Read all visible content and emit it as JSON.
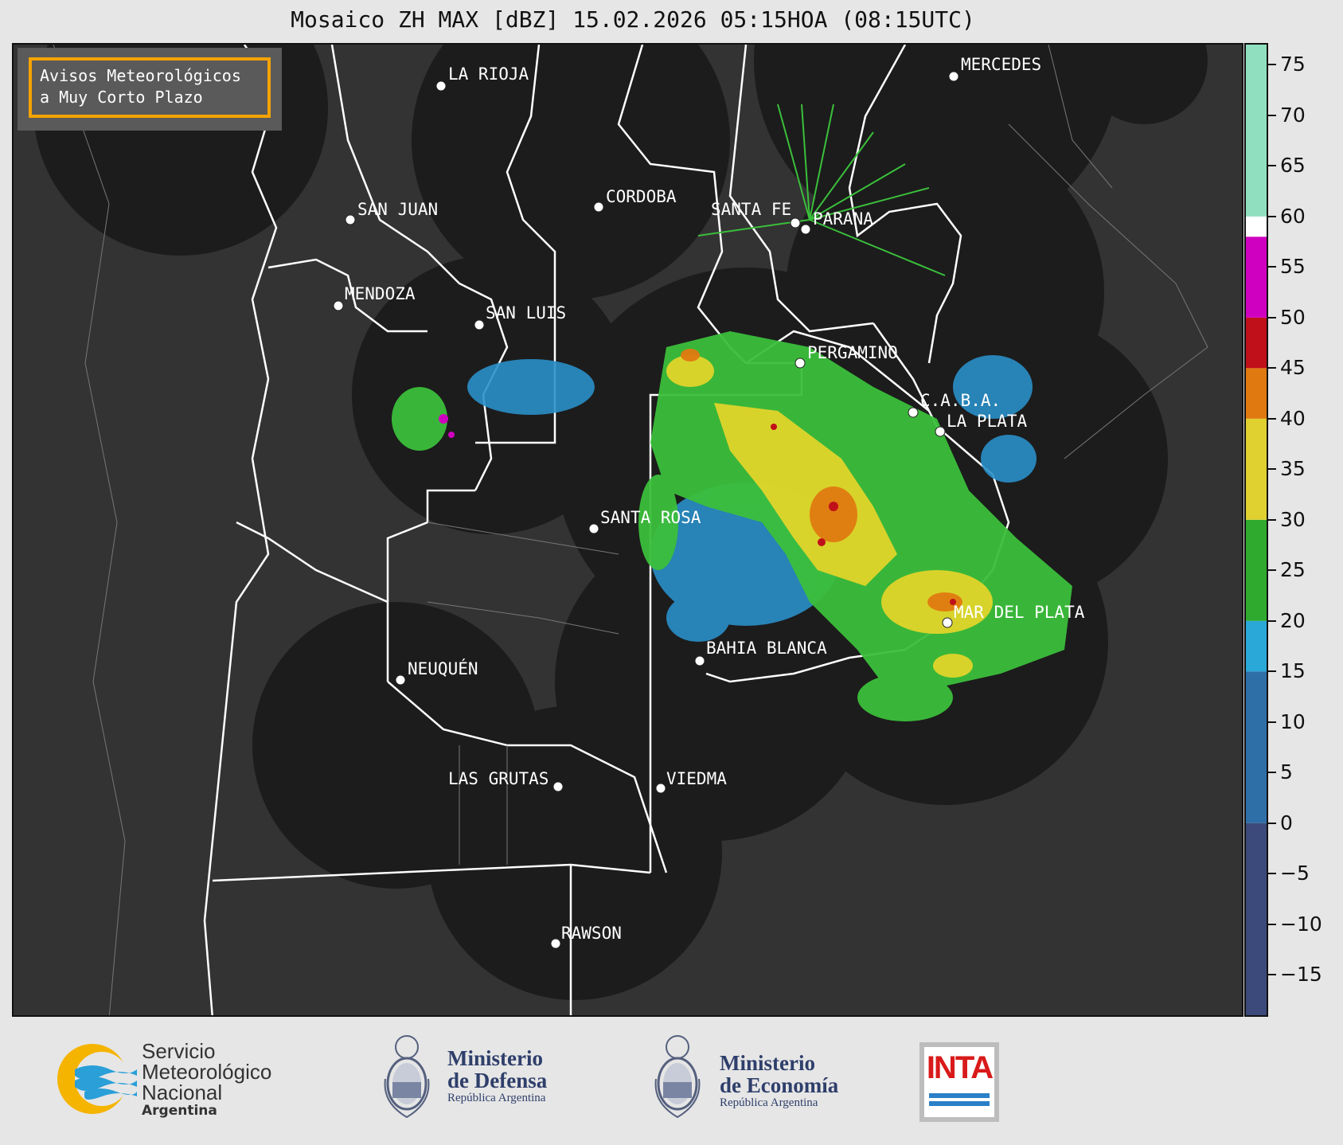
{
  "title": "Mosaico ZH MAX [dBZ] 15.02.2026 05:15HOA (08:15UTC)",
  "notice": {
    "line1": "Avisos Meteorológicos",
    "line2": "a Muy Corto Plazo"
  },
  "cities": [
    {
      "name": "LA RIOJA"
    },
    {
      "name": "MERCEDES"
    },
    {
      "name": "SAN JUAN"
    },
    {
      "name": "CORDOBA"
    },
    {
      "name": "SANTA FE"
    },
    {
      "name": "PARANA"
    },
    {
      "name": "MENDOZA"
    },
    {
      "name": "SAN LUIS"
    },
    {
      "name": "PERGAMINO"
    },
    {
      "name": "C.A.B.A."
    },
    {
      "name": "LA PLATA"
    },
    {
      "name": "SANTA ROSA"
    },
    {
      "name": "MAR DEL PLATA"
    },
    {
      "name": "BAHIA BLANCA"
    },
    {
      "name": "NEUQUÉN"
    },
    {
      "name": "LAS GRUTAS"
    },
    {
      "name": "VIEDMA"
    },
    {
      "name": "RAWSON"
    }
  ],
  "colorbar": {
    "unit": "dBZ",
    "min": -19,
    "max": 77,
    "ticks": [
      "75",
      "70",
      "65",
      "60",
      "55",
      "50",
      "45",
      "40",
      "35",
      "30",
      "25",
      "20",
      "15",
      "10",
      "5",
      "0",
      "−5",
      "−10",
      "−15"
    ],
    "tick_values": [
      75,
      70,
      65,
      60,
      55,
      50,
      45,
      40,
      35,
      30,
      25,
      20,
      15,
      10,
      5,
      0,
      -5,
      -10,
      -15
    ],
    "colors": {
      "below0": "#3b4a7a",
      "0to15": "#2f6fa8",
      "15to20": "#2aa8d8",
      "20to30": "#2faa2f",
      "30to40": "#e0d030",
      "40to45": "#e07a10",
      "45to50": "#c0101a",
      "50to58": "#d000c0",
      "58to60": "#ffffff",
      "60to77": "#90e0c0"
    }
  },
  "footer": {
    "smn": {
      "line1": "Servicio",
      "line2": "Meteorológico",
      "line3": "Nacional",
      "line4": "Argentina"
    },
    "defensa": {
      "line1": "Ministerio",
      "line2": "de Defensa",
      "line3": "República Argentina"
    },
    "economia": {
      "line1": "Ministerio",
      "line2": "de Economía",
      "line3": "República Argentina"
    },
    "inta": {
      "label": "INTA"
    }
  }
}
